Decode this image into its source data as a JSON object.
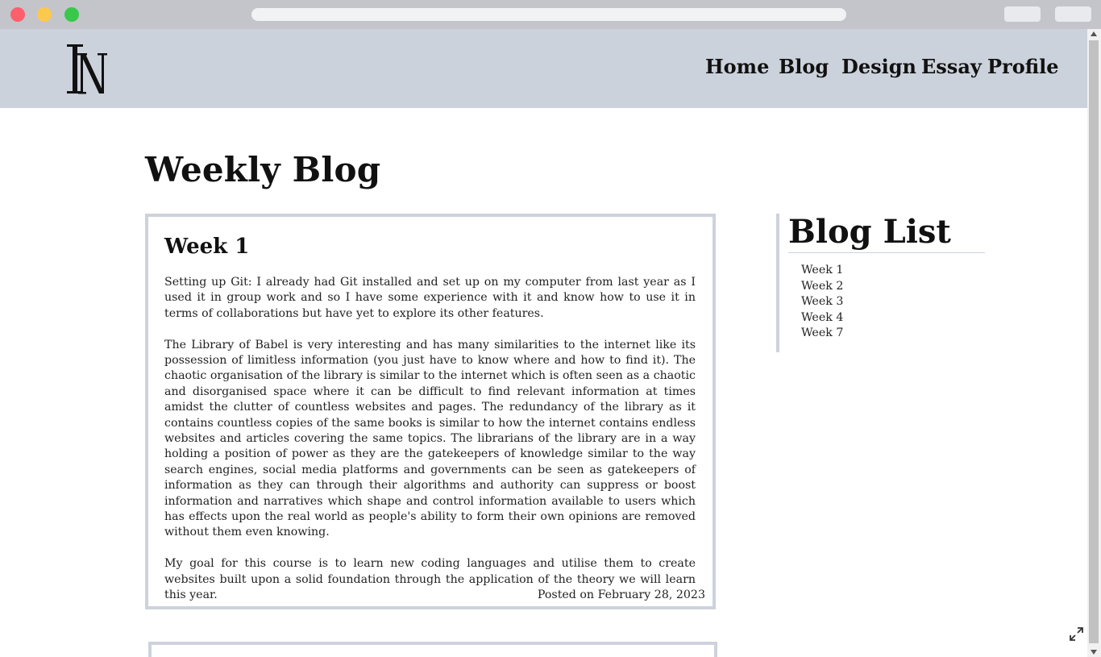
{
  "nav": {
    "home": "Home",
    "blog": "Blog",
    "design": "Design",
    "essay": "Essay",
    "profile": "Profile"
  },
  "page": {
    "title": "Weekly Blog"
  },
  "post": {
    "title": "Week 1",
    "paragraphs": [
      "Setting up Git: I already had Git installed and set up on my computer from last year as I used it in group work and so I have some experience with it and know how to use it in terms of collaborations but have yet to explore its other features.",
      "The Library of Babel is very interesting and has many similarities to the internet like its possession of limitless information (you just have to know where and how to find it). The chaotic organisation of the library is similar to the internet which is often seen as a chaotic and disorganised space where it can be difficult to find relevant information at times amidst the clutter of countless websites and pages. The redundancy of the library as it contains countless copies of the same books is similar to how the internet contains endless websites and articles covering the same topics. The librarians of the library are in a way holding a position of power as they are the gatekeepers of knowledge similar to the way search engines, social media platforms and governments can be seen as gatekeepers of information as they can through their algorithms and authority can suppress or boost information and narratives which shape and control information available to users which has effects upon the real world as people's ability to form their own opinions are removed without them even knowing.",
      "My goal for this course is to learn new coding languages and utilise them to create websites built upon a solid foundation through the application of the theory we will learn this year."
    ],
    "date": "Posted on February 28, 2023"
  },
  "sidebar": {
    "title": "Blog List",
    "items": [
      "Week 1",
      "Week 2",
      "Week 3",
      "Week 4",
      "Week 7"
    ]
  },
  "icons": {
    "logo": "NI monogram logo",
    "expand": "expand-icon"
  }
}
